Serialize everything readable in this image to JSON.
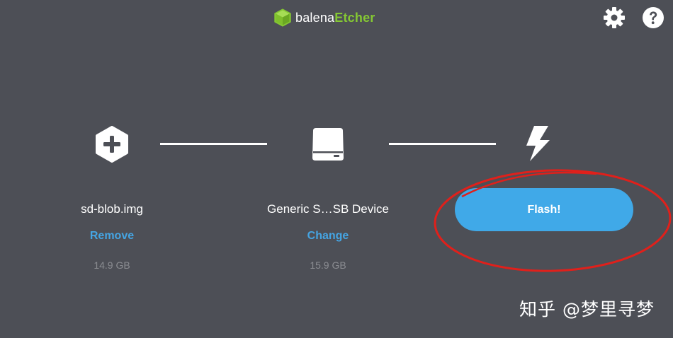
{
  "header": {
    "brand": "balena",
    "product": "Etcher",
    "logo_icon": "cube-icon",
    "settings_icon": "gear-icon",
    "help_icon": "question-icon"
  },
  "steps": {
    "image": {
      "icon": "plus-hexagon-icon",
      "name": "sd-blob.img",
      "action": "Remove",
      "size": "14.9 GB"
    },
    "drive": {
      "icon": "drive-icon",
      "name": "Generic S…SB Device",
      "action": "Change",
      "size": "15.9 GB"
    },
    "flash": {
      "icon": "lightning-icon",
      "button_label": "Flash!"
    }
  },
  "watermark": "知乎 @梦里寻梦",
  "colors": {
    "background": "#4d4f56",
    "accent": "#40a9e8",
    "link": "#45a5e3",
    "brand_green": "#85c833",
    "annotation": "#e0201b"
  }
}
